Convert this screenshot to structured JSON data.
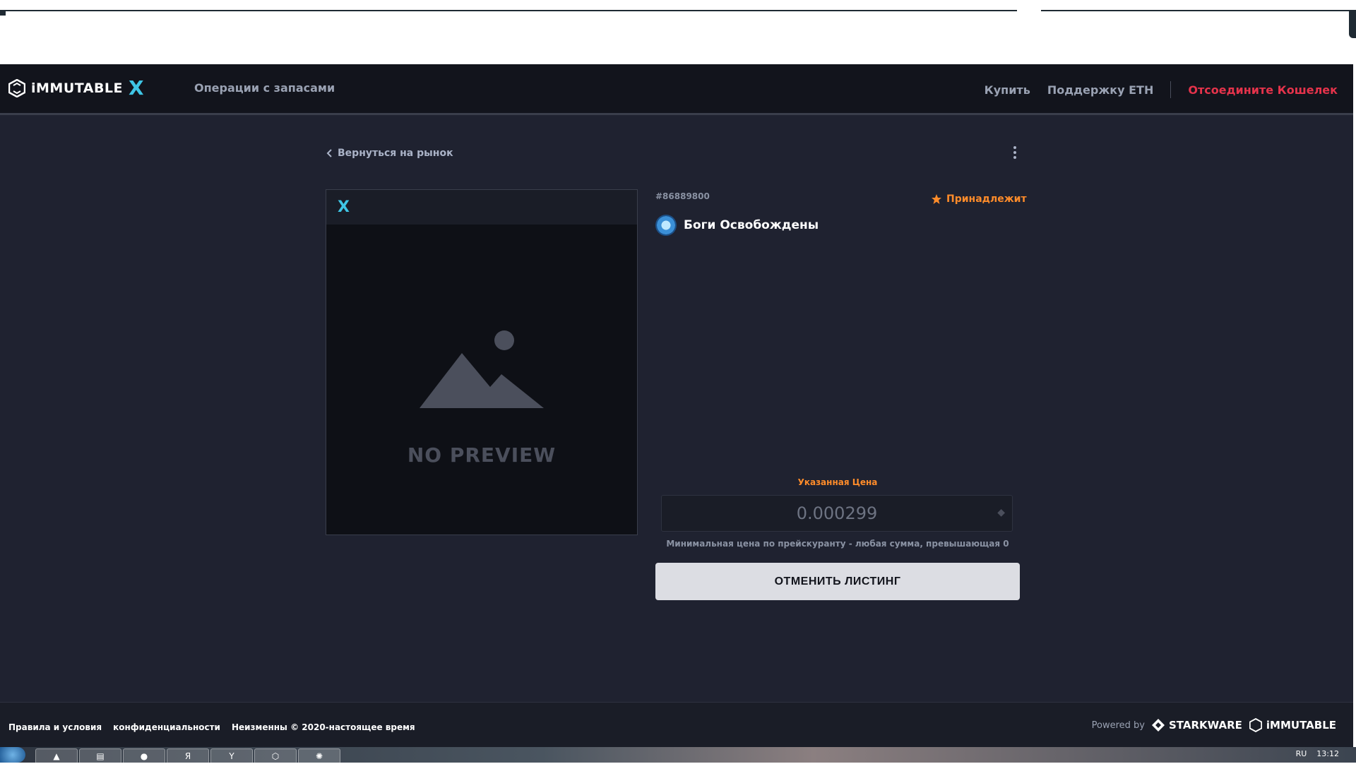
{
  "brand": {
    "logo_text": "iMMUTABLE",
    "logo_x": "X",
    "accent": "#3fc6e6"
  },
  "nav": {
    "inventory": "Операции с запасами",
    "buy": "Купить",
    "eth_support": "Поддержку ETH",
    "disconnect": "Отсоедините Кошелек"
  },
  "back_link": "Вернуться на рынок",
  "asset": {
    "token_id": "#86889800",
    "owned_label": "Принадлежит",
    "collection_name": "Боги Освобождены",
    "no_preview": "NO PREVIEW"
  },
  "listing": {
    "price_label": "Указанная Цена",
    "price_value": "0.000299",
    "price_hint": "Минимальная цена по прейскуранту - любая сумма, превышающая 0",
    "cancel_button": "ОТМЕНИТЬ ЛИСТИНГ"
  },
  "footer": {
    "terms": "Правила и условия",
    "privacy": "конфиденциальности",
    "copyright": "Неизменны © 2020-настоящее время",
    "powered_by": "Powered by",
    "starkware": "STARKWARE",
    "immutable": "iMMUTABLE"
  },
  "taskbar": {
    "lang": "RU",
    "time": "13:12"
  },
  "colors": {
    "danger": "#e5334b",
    "orange": "#ff8c2a",
    "bg": "#1f2230",
    "topbar": "#12141c"
  }
}
